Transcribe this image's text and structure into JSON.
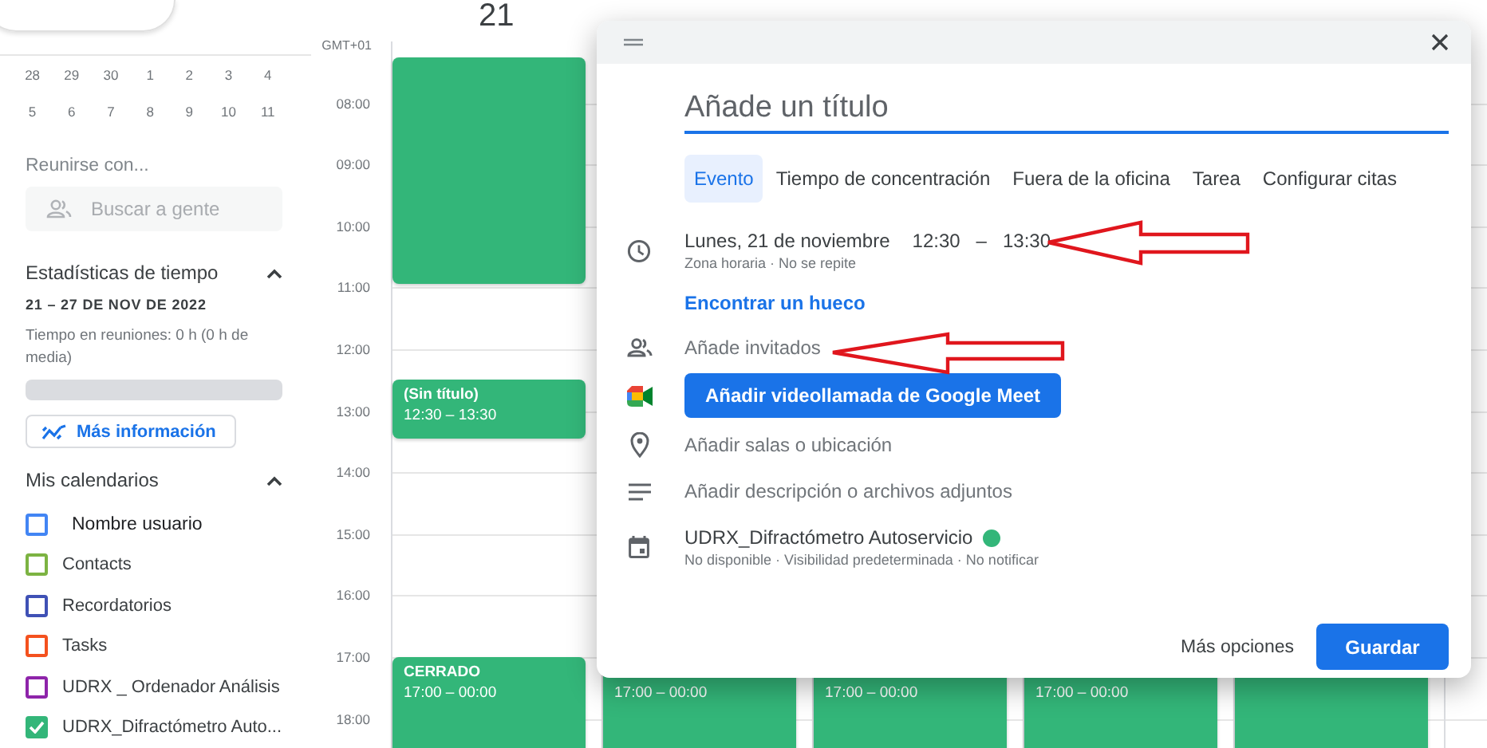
{
  "mini_calendar": {
    "weeks": [
      [
        "28",
        "29",
        "30",
        "1",
        "2",
        "3",
        "4"
      ],
      [
        "5",
        "6",
        "7",
        "8",
        "9",
        "10",
        "11"
      ]
    ]
  },
  "meet_with": {
    "heading": "Reunirse con...",
    "search": {
      "placeholder": "Buscar a gente"
    }
  },
  "time_insights": {
    "heading": "Estadísticas de tiempo",
    "expanded": true,
    "range": "21 – 27 DE NOV DE 2022",
    "summary": "Tiempo en reuniones: 0 h (0 h de media)",
    "button": "Más información"
  },
  "my_calendars": {
    "heading": "Mis calendarios",
    "expanded": true,
    "items": [
      {
        "name": "Nombre usuario",
        "color": "#4285f4",
        "checked": false
      },
      {
        "name": "Contacts",
        "color": "#7cb342",
        "checked": false
      },
      {
        "name": "Recordatorios",
        "color": "#3f51b5",
        "checked": false
      },
      {
        "name": "Tasks",
        "color": "#f4511e",
        "checked": false
      },
      {
        "name": "UDRX _ Ordenador Análisis",
        "color": "#8e24aa",
        "checked": false
      },
      {
        "name": "UDRX_Difractómetro Auto...",
        "color": "#33b679",
        "checked": true
      }
    ]
  },
  "calendar": {
    "day_number": "21",
    "timezone": "GMT+01",
    "hours": [
      "08:00",
      "09:00",
      "10:00",
      "11:00",
      "12:00",
      "13:00",
      "14:00",
      "15:00",
      "16:00",
      "17:00",
      "18:00"
    ],
    "columns": [
      {
        "events": [
          {
            "kind": "block"
          },
          {
            "kind": "block",
            "title": "(Sin título)",
            "time": "12:30 – 13:30"
          },
          {
            "kind": "block",
            "title": "CERRADO",
            "time": "17:00 – 00:00"
          }
        ]
      },
      {
        "events": [
          {
            "kind": "block",
            "time": "17:00 – 00:00"
          }
        ]
      },
      {
        "events": [
          {
            "kind": "block",
            "time": "17:00 – 00:00"
          }
        ]
      },
      {
        "events": [
          {
            "kind": "block",
            "time": "17:00 – 00:00"
          }
        ]
      },
      {
        "events": [
          {
            "kind": "block"
          }
        ]
      }
    ]
  },
  "dialog": {
    "title": {
      "placeholder": "Añade un título"
    },
    "tabs": [
      {
        "label": "Evento",
        "selected": true
      },
      {
        "label": "Tiempo de concentración",
        "selected": false
      },
      {
        "label": "Fuera de la oficina",
        "selected": false
      },
      {
        "label": "Tarea",
        "selected": false
      },
      {
        "label": "Configurar citas",
        "selected": false
      }
    ],
    "date": "Lunes, 21 de noviembre",
    "start_time": "12:30",
    "separator": "–",
    "end_time": "13:30",
    "recurrence": "Zona horaria · No se repite",
    "find_time": "Encontrar un hueco",
    "guests": "Añade invitados",
    "meet_button": "Añadir videollamada de Google Meet",
    "location": "Añadir salas o ubicación",
    "description": "Añadir descripción o archivos adjuntos",
    "calendar": {
      "name": "UDRX_Difractómetro Autoservicio",
      "color": "#33b679",
      "details": "No disponible · Visibilidad predeterminada · No notificar"
    },
    "more_options": "Más opciones",
    "save": "Guardar"
  }
}
